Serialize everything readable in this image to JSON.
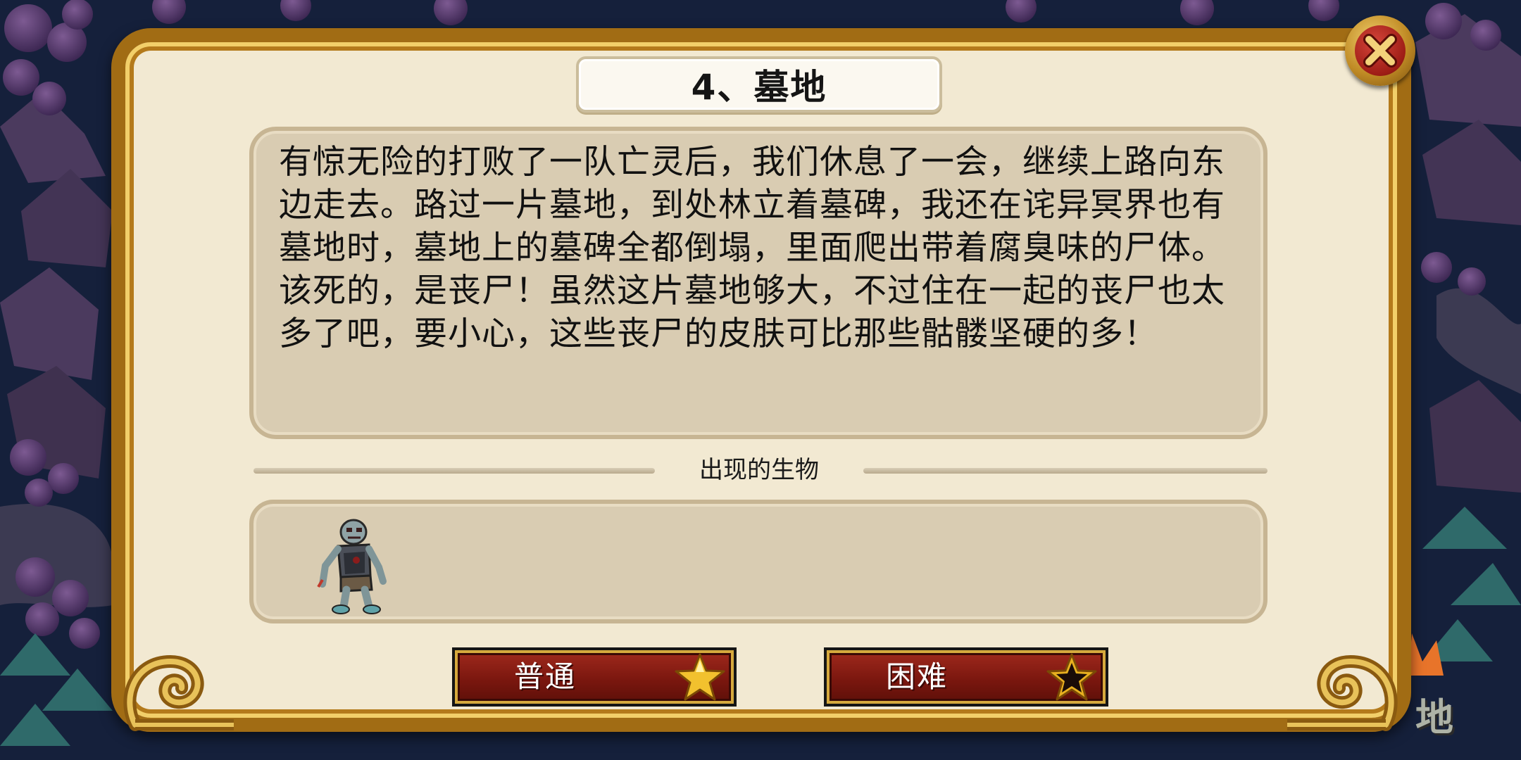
{
  "dialog": {
    "title": "4、墓地",
    "story": "有惊无险的打败了一队亡灵后，我们休息了一会，继续上路向东边走去。路过一片墓地，到处林立着墓碑，我还在诧异冥界也有墓地时，墓地上的墓碑全都倒塌，里面爬出带着腐臭味的尸体。该死的，是丧尸！虽然这片墓地够大，不过住在一起的丧尸也太多了吧，要小心，这些丧尸的皮肤可比那些骷髅坚硬的多！",
    "creatures_heading": "出现的生物",
    "creatures": [
      {
        "icon": "zombie-icon"
      }
    ],
    "buttons": {
      "normal": {
        "label": "普通",
        "icon": "gold-star-icon"
      },
      "hard": {
        "label": "困难",
        "icon": "dark-star-icon"
      }
    },
    "close_icon": "close-icon"
  },
  "background": {
    "map_label": "地"
  },
  "colors": {
    "frame_gold": "#a16c14",
    "panel": "#d9ccb2",
    "parchment": "#f2e9d2",
    "button_red": "#7b170f",
    "close_red": "#9e1d16",
    "star_gold": "#f2c12e"
  }
}
